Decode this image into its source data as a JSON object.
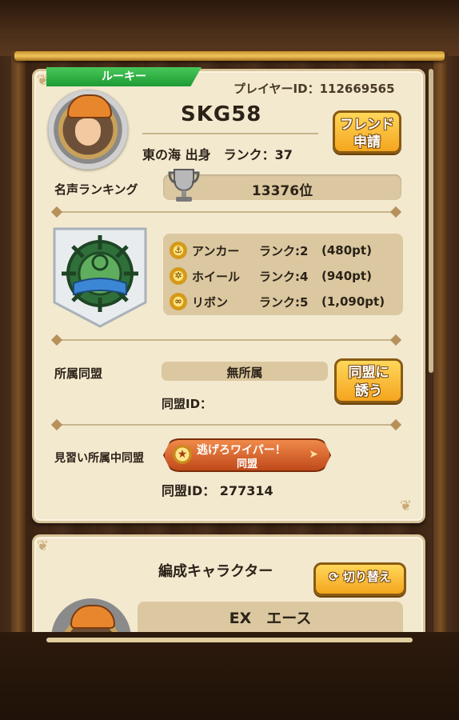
{
  "profile": {
    "title_badge": "ルーキー",
    "player_id": "プレイヤーID：112669565",
    "name": "SKG58",
    "origin_rank": "東の海 出身　ランク：37",
    "friend_button": "フレンド\n申請"
  },
  "fame": {
    "label": "名声ランキング",
    "value": "13376位"
  },
  "medals": [
    {
      "name": "アンカー",
      "rank": "ランク:2",
      "pts": "(480pt)"
    },
    {
      "name": "ホイール",
      "rank": "ランク:4",
      "pts": "(940pt)"
    },
    {
      "name": "リボン",
      "rank": "ランク:5",
      "pts": "(1,090pt)"
    }
  ],
  "alliance": {
    "label": "所属同盟",
    "value": "無所属",
    "id": "同盟ID：",
    "invite_button": "同盟に\n誘う"
  },
  "trainee": {
    "label": "見習い所属中同盟",
    "name": "逃げろワイパー！",
    "sub": "同盟",
    "id": "同盟ID：  277314"
  },
  "formation": {
    "label": "編成キャラクター",
    "switch_button": "切り替え",
    "character": "EX　エース"
  },
  "colors": {
    "panel": "#f3e9cf",
    "accent_orange": "#f4a51e",
    "badge_green": "#2fb044"
  }
}
